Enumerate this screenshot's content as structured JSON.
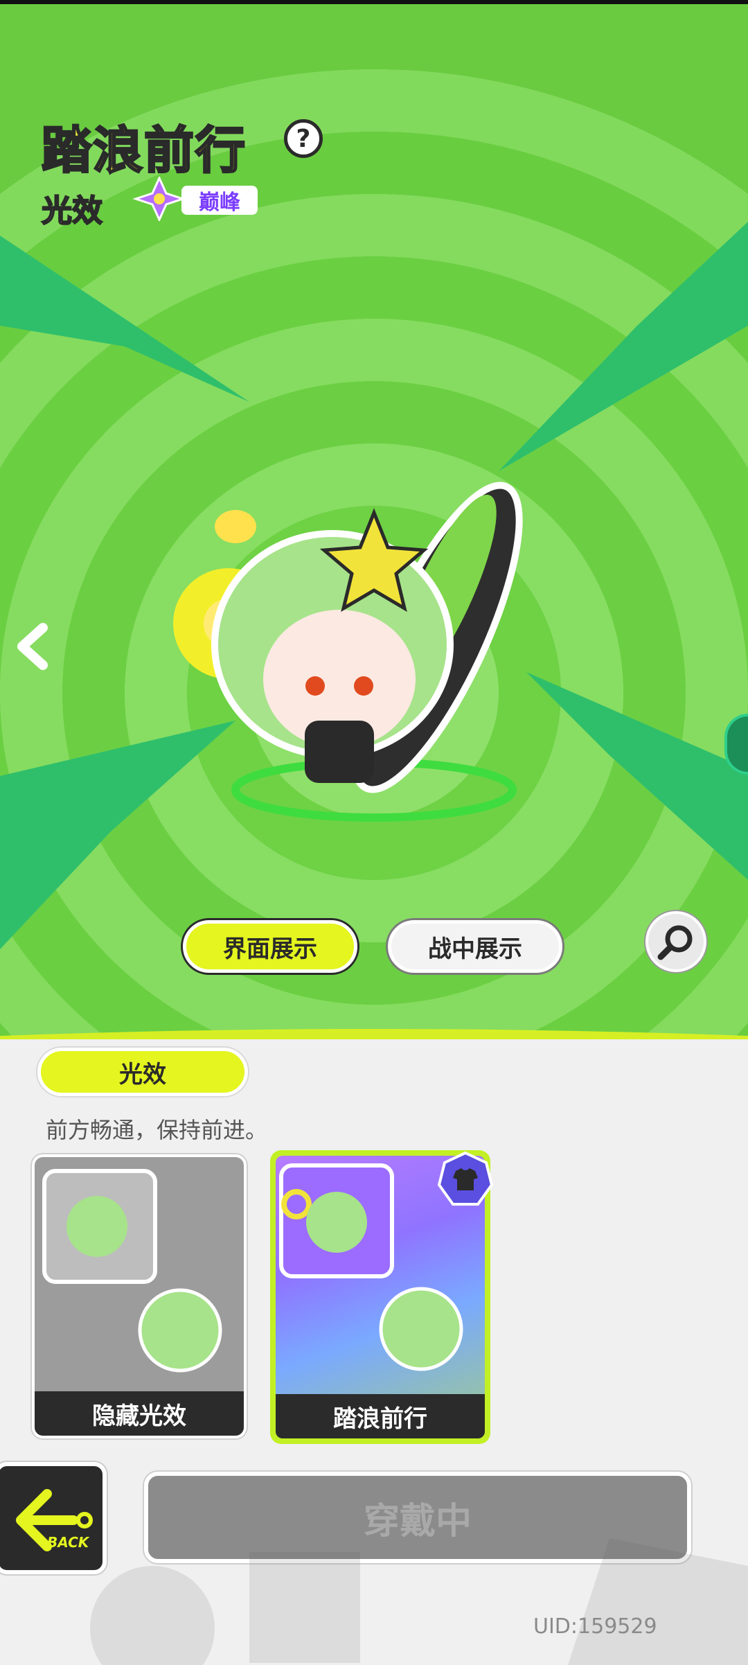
{
  "header": {
    "title": "踏浪前行",
    "category": "光效",
    "rank": "巅峰"
  },
  "view_tabs": [
    {
      "label": "界面展示",
      "active": true
    },
    {
      "label": "战中展示",
      "active": false
    }
  ],
  "section": {
    "label": "光效",
    "description": "前方畅通，保持前进。"
  },
  "effects": [
    {
      "label": "隐藏光效",
      "selected": false
    },
    {
      "label": "踏浪前行",
      "selected": true,
      "equipped": true
    }
  ],
  "footer": {
    "back_label": "BACK",
    "action_label": "穿戴中",
    "uid": "UID:159529"
  },
  "colors": {
    "accent": "#e4f51f",
    "background_green": "#7bd94f"
  }
}
